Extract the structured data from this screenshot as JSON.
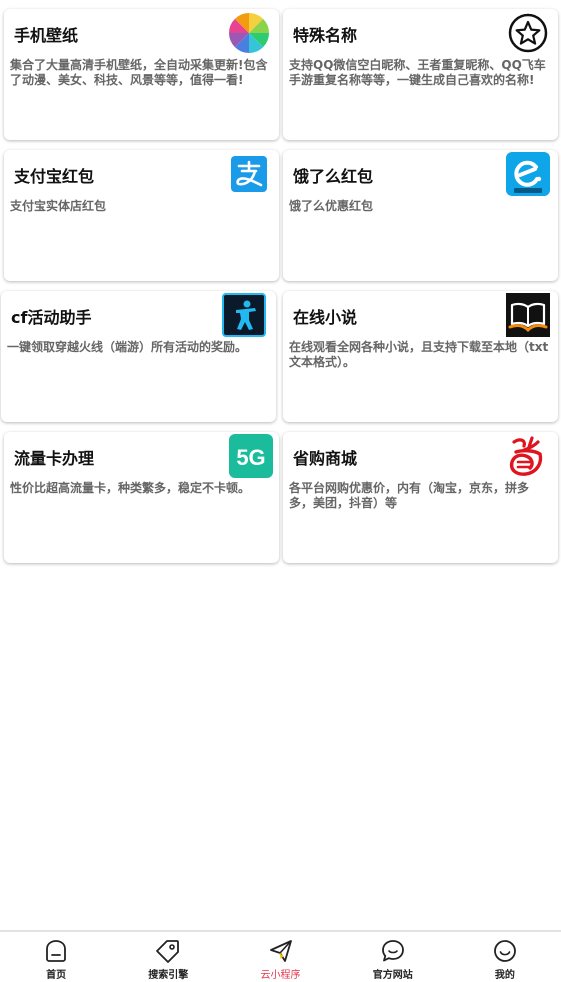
{
  "cards": [
    {
      "title": "手机壁纸",
      "desc": "集合了大量高清手机壁纸，全自动采集更新!包含了动漫、美女、科技、风景等等，值得一看!",
      "icon": "color-wheel-icon"
    },
    {
      "title": "特殊名称",
      "desc": "支持QQ微信空白昵称、王者重复昵称、QQ飞车手游重复名称等等，一键生成自己喜欢的名称!",
      "icon": "star-badge-icon"
    },
    {
      "title": "支付宝红包",
      "desc": "支付宝实体店红包",
      "icon": "alipay-logo-icon"
    },
    {
      "title": "饿了么红包",
      "desc": "饿了么优惠红包",
      "icon": "eleme-logo-icon"
    },
    {
      "title": "cf活动助手",
      "desc": "一键领取穿越火线（端游）所有活动的奖励。",
      "icon": "soldier-icon"
    },
    {
      "title": "在线小说",
      "desc": "在线观看全网各种小说，且支持下载至本地（txt文本格式）。",
      "icon": "book-icon"
    },
    {
      "title": "流量卡办理",
      "desc": "性价比超高流量卡，种类繁多，稳定不卡顿。",
      "icon": "5g-icon"
    },
    {
      "title": "省购商城",
      "desc": "各平台网购优惠价，内有（淘宝，京东，拼多多，美团，抖音）等",
      "icon": "sheng-logo-icon"
    }
  ],
  "tabs": [
    {
      "label": "首页",
      "icon": "home-icon"
    },
    {
      "label": "搜索引擎",
      "icon": "tag-icon"
    },
    {
      "label": "云小程序",
      "icon": "paper-plane-icon",
      "active": true
    },
    {
      "label": "官方网站",
      "icon": "chat-bubble-icon"
    },
    {
      "label": "我的",
      "icon": "smile-icon"
    }
  ],
  "colors": {
    "active_tab": "#e8334a",
    "alipay_blue": "#1a9bea",
    "eleme_blue": "#0ea5e9",
    "fiveg_green": "#1abc9c"
  }
}
